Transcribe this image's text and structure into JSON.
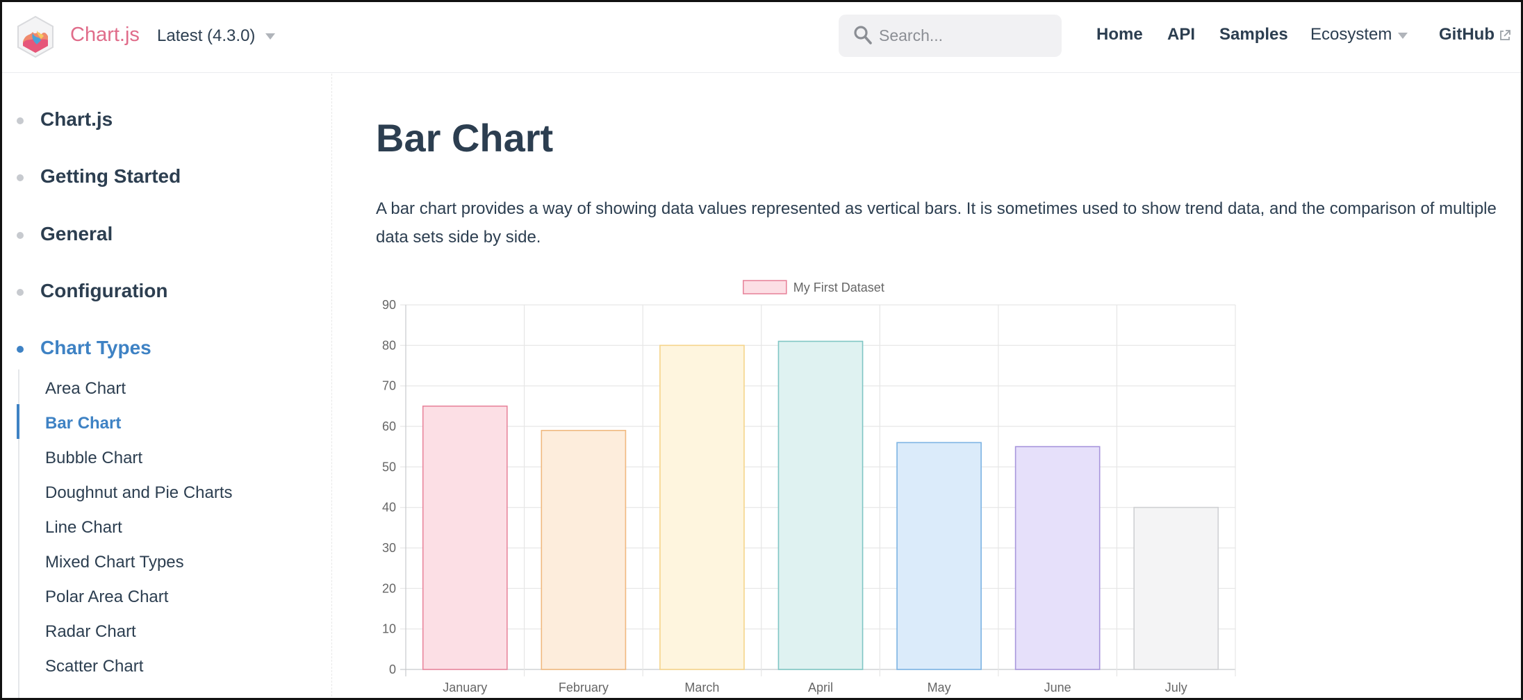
{
  "navbar": {
    "brand": "Chart.js",
    "version": "Latest (4.3.0)",
    "search_placeholder": "Search...",
    "links": {
      "home": "Home",
      "api": "API",
      "samples": "Samples",
      "ecosystem": "Ecosystem",
      "github": "GitHub"
    }
  },
  "sidebar": {
    "sections": {
      "chartjs": "Chart.js",
      "getting_started": "Getting Started",
      "general": "General",
      "configuration": "Configuration",
      "chart_types": "Chart Types"
    },
    "items": [
      "Area Chart",
      "Bar Chart",
      "Bubble Chart",
      "Doughnut and Pie Charts",
      "Line Chart",
      "Mixed Chart Types",
      "Polar Area Chart",
      "Radar Chart",
      "Scatter Chart"
    ],
    "active_item": "Bar Chart"
  },
  "main": {
    "title": "Bar Chart",
    "lead": "A bar chart provides a way of showing data values represented as vertical bars. It is sometimes used to show trend data, and the comparison of multiple data sets side by side."
  },
  "colors": {
    "accent": "#3e82c4",
    "brand": "#e06c8a",
    "text": "#2c3e50"
  },
  "chart_data": {
    "type": "bar",
    "categories": [
      "January",
      "February",
      "March",
      "April",
      "May",
      "June",
      "July"
    ],
    "series": [
      {
        "name": "My First Dataset",
        "values": [
          65,
          59,
          80,
          81,
          56,
          55,
          40
        ]
      }
    ],
    "ylim": [
      0,
      90
    ],
    "yticks": [
      0,
      10,
      20,
      30,
      40,
      50,
      60,
      70,
      80,
      90
    ],
    "grid": true,
    "legend": "top",
    "bar_fill_colors": [
      "#fcdfe5",
      "#fdeddc",
      "#fef5de",
      "#dff2f1",
      "#dbebfa",
      "#e6e0fa",
      "#f4f4f5"
    ],
    "bar_border_colors": [
      "#e8869d",
      "#f0b97f",
      "#f5d48a",
      "#7fc6c4",
      "#7cb3e3",
      "#a896dc",
      "#cfd0d3"
    ]
  }
}
